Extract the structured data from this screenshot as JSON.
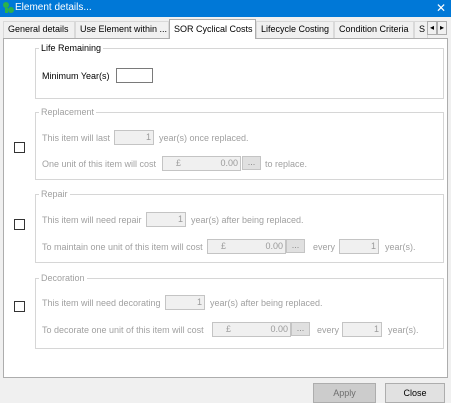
{
  "window": {
    "title": "Element details...",
    "close_glyph": "✕"
  },
  "tabs": [
    {
      "label": "General details"
    },
    {
      "label": "Use Element within ..."
    },
    {
      "label": "SOR Cyclical Costs"
    },
    {
      "label": "Lifecycle Costing"
    },
    {
      "label": "Condition Criteria"
    },
    {
      "label": "S"
    }
  ],
  "tab_scroll": {
    "left": "◂",
    "right": "▸"
  },
  "life_remaining": {
    "title": "Life Remaining",
    "min_years_label": "Minimum Year(s)",
    "min_years_value": ""
  },
  "replacement": {
    "title": "Replacement",
    "last_label": "This item will last",
    "last_value": "1",
    "last_suffix": "year(s) once replaced.",
    "cost_label": "One unit of this item will cost",
    "currency": "£",
    "cost_value": "0.00",
    "cost_button": "...",
    "cost_suffix": "to replace."
  },
  "repair": {
    "title": "Repair",
    "need_label": "This item will need repair",
    "need_value": "1",
    "need_suffix": "year(s) after being replaced.",
    "cost_label": "To maintain one unit of this item will cost",
    "currency": "£",
    "cost_value": "0.00",
    "cost_button": "...",
    "every_label": "every",
    "every_value": "1",
    "every_suffix": "year(s)."
  },
  "decoration": {
    "title": "Decoration",
    "need_label": "This item will need decorating",
    "need_value": "1",
    "need_suffix": "year(s) after being replaced.",
    "cost_label": "To decorate one unit of this item will cost",
    "currency": "£",
    "cost_value": "0.00",
    "cost_button": "...",
    "every_label": "every",
    "every_value": "1",
    "every_suffix": "year(s)."
  },
  "buttons": {
    "apply": "Apply",
    "close": "Close"
  },
  "colors": {
    "titlebar": "#0078d7",
    "disabled_text": "#a0a0a0"
  }
}
